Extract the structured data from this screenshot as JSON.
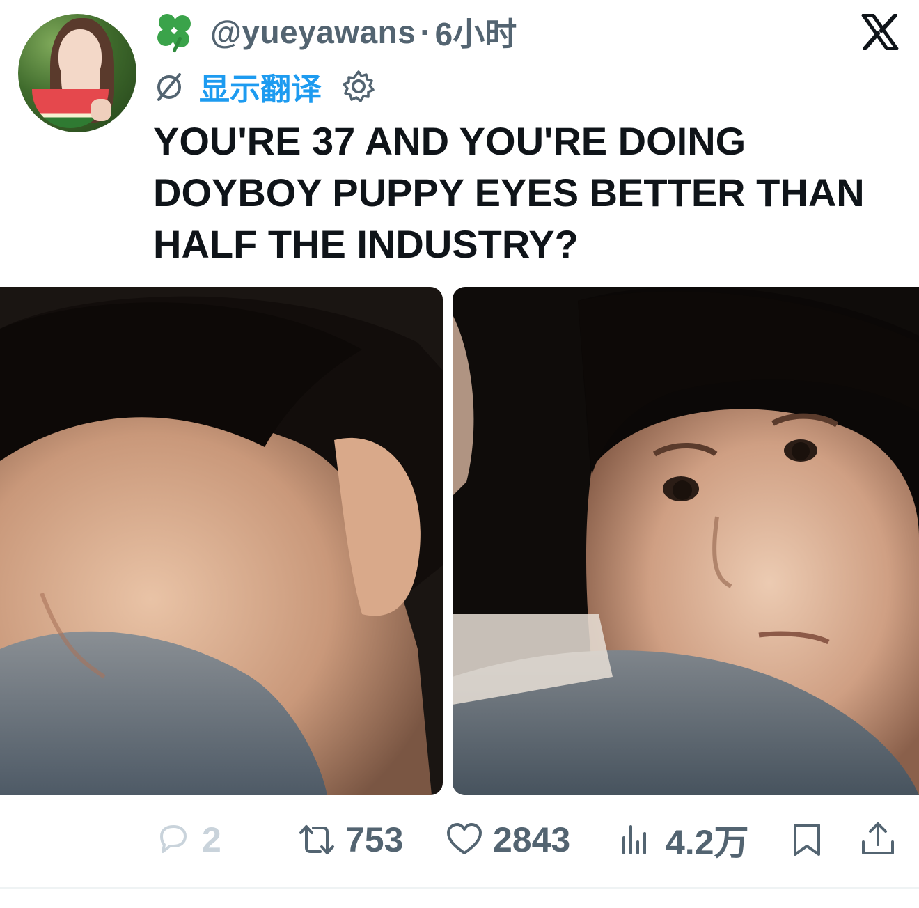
{
  "post": {
    "handle": "@yueyawans",
    "separator": "·",
    "time": "6小时",
    "translate_label": "显示翻译",
    "text": "YOU'RE 37 AND YOU'RE DOING\nDOYBOY PUPPY EYES BETTER THAN\nHALF THE INDUSTRY?"
  },
  "icons": {
    "prefix_emoji": "four-leaf-clover-icon",
    "brand": "x-logo",
    "translate": "globe-off-icon",
    "settings": "gear-icon",
    "reply": "reply-icon",
    "retweet": "retweet-icon",
    "like": "heart-icon",
    "views": "views-chart-icon",
    "bookmark": "bookmark-icon",
    "share": "share-icon"
  },
  "actions": {
    "reply_count": "2",
    "retweet_count": "753",
    "like_count": "2843",
    "views_count": "4.2万"
  },
  "colors": {
    "accent": "#1d9bf0",
    "secondary_text": "#536471",
    "primary_text": "#0f1419",
    "faded": "#c9d3db"
  }
}
